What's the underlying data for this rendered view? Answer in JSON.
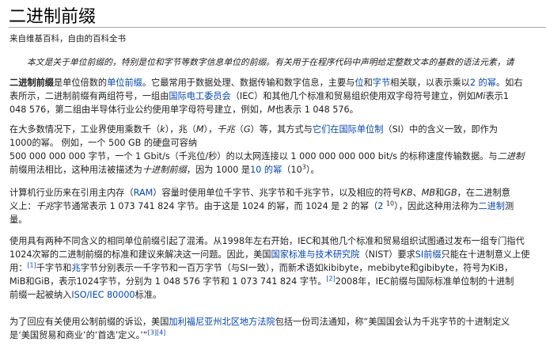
{
  "title": "二进制前缀",
  "site_sub": "来自维基百科，自由的百科全书",
  "hatnote": "本文是关于单位前缀的，特别是位和字节等数字信息单位的前缀。有关用于在程序代码中声明给定整数文本的基数的语法元素，请",
  "p1": {
    "a": "二进制前缀",
    "b": "是单位倍数的",
    "link1": "单位前缀",
    "c": "。它最常用于数据处理、数据传输和数字信息，主要与",
    "link2": "位",
    "d": "和",
    "link3": "字节",
    "e": "相关联，以表示乘以",
    "link4": "2 的幂",
    "f": "。如右",
    "g": "表所示，二进制前缀有两组符号，一组由",
    "link5": "国际电工委员会",
    "h": "（IEC）和其他几个标准和贸易组织使用双字母符号建立，例如",
    "i1": "Mi",
    "j": "表示1",
    "k": "048 576，第二组由半导体行业公约使用单字母符号建立，例如，",
    "i2": "M",
    "l": "也表示 1 048 576。"
  },
  "p2": {
    "a": "在大多数情况下，工业界使用乘数千（",
    "i1": "k",
    "b": "），兆（",
    "i2": "M",
    "c": "），",
    "i3": "千兆",
    "d": "（",
    "i4": "G",
    "e": "）等，其方式与",
    "link1": "它们在国际单位制",
    "f": "（SI）中的含义一致，即作为",
    "g": "1000的幂。 例如，一个 500 GB 的硬盘可容纳",
    "h": "500 000 000 000 字节，一个 1 Gbit/s（千兆位/秒）的以太网连接以 1 000 000 000   000  bit/s 的标称速度传输数据。与",
    "i5": "二进制",
    "i": "前缀用法相比，这种用法被描述为",
    "i6": "十进制前缀",
    "j": "，因为 1000 是",
    "link2": "10 的幂",
    "k": "（10",
    "sup": "3",
    "l": "）。"
  },
  "p3": {
    "a": "计算机行业历来在引用主内存（",
    "link1": "RAM",
    "b": "）容量时使用单位千字节、兆字节和千兆字节，以及相应的符号",
    "i1": "KB",
    "c": "、",
    "i2": "MB",
    "d": "和",
    "i3": "GB",
    "e": "，在二进制意",
    "f": "义上：",
    "i4": "千兆",
    "g": "字节通常表示 1 073 741 824 字节。由于这是 1024 的幂，而 1024 是 2 的幂（",
    "link2": "2 ",
    "sup": "10",
    "h": "），因此这种用法称为",
    "link3": "二进制",
    "i": "测",
    "j": "量。"
  },
  "p4": {
    "a": "使用具有两种不同含义的相同单位前缀引起了混淆。从1998年左右开始，IEC和其他几个标准和贸易组织试图通过发布一组专门指代",
    "b": "1024次幂的二进制前缀的标准和建议来解决这一问题。因此，美国",
    "link1": "国家标准与技术研究院",
    "c": "（NIST）要求",
    "link2": "SI前缀",
    "d": "只能在十进制意义上使",
    "e": "用：",
    "ref1": "[1]",
    "f": "千字节和",
    "link3": "兆",
    "g": "字节分别表示一千字节和一百万字节（与SI一致），而新术语如kibibyte，mebibyte和gibibyte，符号为KiB，",
    "h": "MiB和GiB，表示1024字节，",
    "i": "分别为 1 048  576 字节和 1 073 741 824 字节。",
    "ref2": "[2]",
    "j": "2008年，IEC前缀与国际标准单位制的十进制",
    "k": "前缀一起被纳入",
    "link4": "ISO/IEC 80000",
    "l": "标准。"
  },
  "p5": {
    "a": "为了回应有关使用公制前缀的诉讼，美国",
    "link1": "加利福尼亚州北区地方法院",
    "b": "包括一份司法通知，称“美国国会认为千兆字节的十进制定义",
    "c": "是‘美国贸易和商业’的‘首选’定义。’“",
    "ref3": "[3]",
    "ref4": "[4]"
  }
}
